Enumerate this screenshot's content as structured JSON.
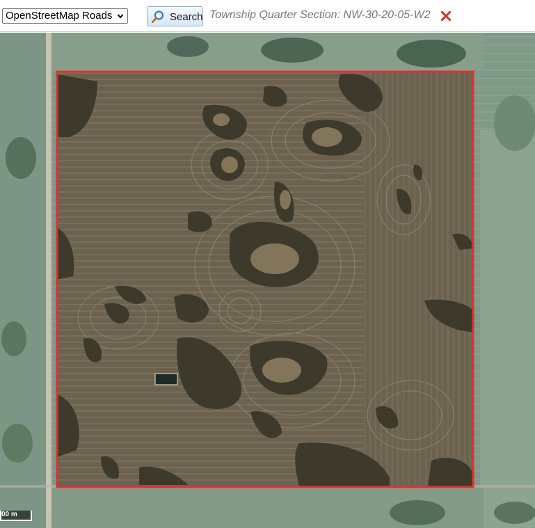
{
  "toolbar": {
    "layer_select": {
      "value": "OpenStreetMap Roads"
    },
    "search_button": {
      "label": "Search"
    },
    "section_label": "Township Quarter Section: NW-30-20-05-W2"
  },
  "map": {
    "scale_label": "00 m",
    "colors": {
      "boundary": "#e03030",
      "field": "#6b6350",
      "grass": "#7f9a86",
      "trees": "#3a3a2a",
      "road": "#c9c4b2"
    }
  }
}
